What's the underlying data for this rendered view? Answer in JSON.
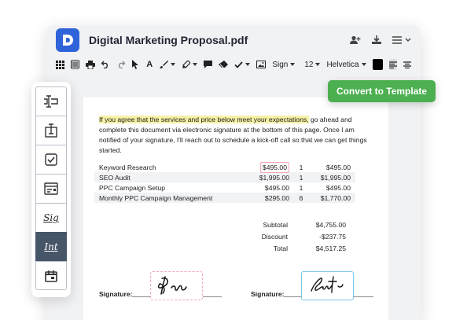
{
  "window": {
    "title": "Digital Marketing Proposal.pdf"
  },
  "toolbar": {
    "sign_label": "Sign",
    "font_size": "12",
    "font_family": "Helvetica",
    "text_color": "#000000"
  },
  "convert_button": {
    "label": "Convert to Template",
    "color": "#4caf50"
  },
  "document": {
    "intro_highlight": "If you agree that the services and price below meet your expectations,",
    "intro_rest": " go ahead and complete this document via electronic signature at the bottom of this page. Once I am notified of your signature, I'll reach out to schedule a kick-off call so that we can get things started.",
    "line_items": [
      {
        "name": "Keyword Research",
        "price": "$495.00",
        "qty": "1",
        "total": "$495.00"
      },
      {
        "name": "SEO Audit",
        "price": "$1,995.00",
        "qty": "1",
        "total": "$1,995.00"
      },
      {
        "name": "PPC Campaign Setup",
        "price": "$495.00",
        "qty": "1",
        "total": "$495.00"
      },
      {
        "name": "Monthly PPC Campaign Management",
        "price": "$295.00",
        "qty": "6",
        "total": "$1,770.00"
      }
    ],
    "totals": {
      "subtotal_label": "Subtotal",
      "subtotal": "$4,755.00",
      "discount_label": "Discount",
      "discount": "-$237.75",
      "total_label": "Total",
      "total": "$4,517.25"
    },
    "signature_label_1": "Signature:",
    "signature_label_2": "Signature:"
  },
  "sidebar": {
    "items": [
      {
        "icon": "text-field-icon"
      },
      {
        "icon": "text-block-icon"
      },
      {
        "icon": "checkbox-icon"
      },
      {
        "icon": "dropdown-field-icon"
      },
      {
        "icon": "signature-field-icon",
        "text": "Sig"
      },
      {
        "icon": "initials-field-icon",
        "text": "Int"
      },
      {
        "icon": "date-field-icon"
      }
    ],
    "active_index": 5
  },
  "colors": {
    "accent": "#2f63d9",
    "highlight": "#f4f1a6",
    "sidebar_active": "#475569"
  }
}
